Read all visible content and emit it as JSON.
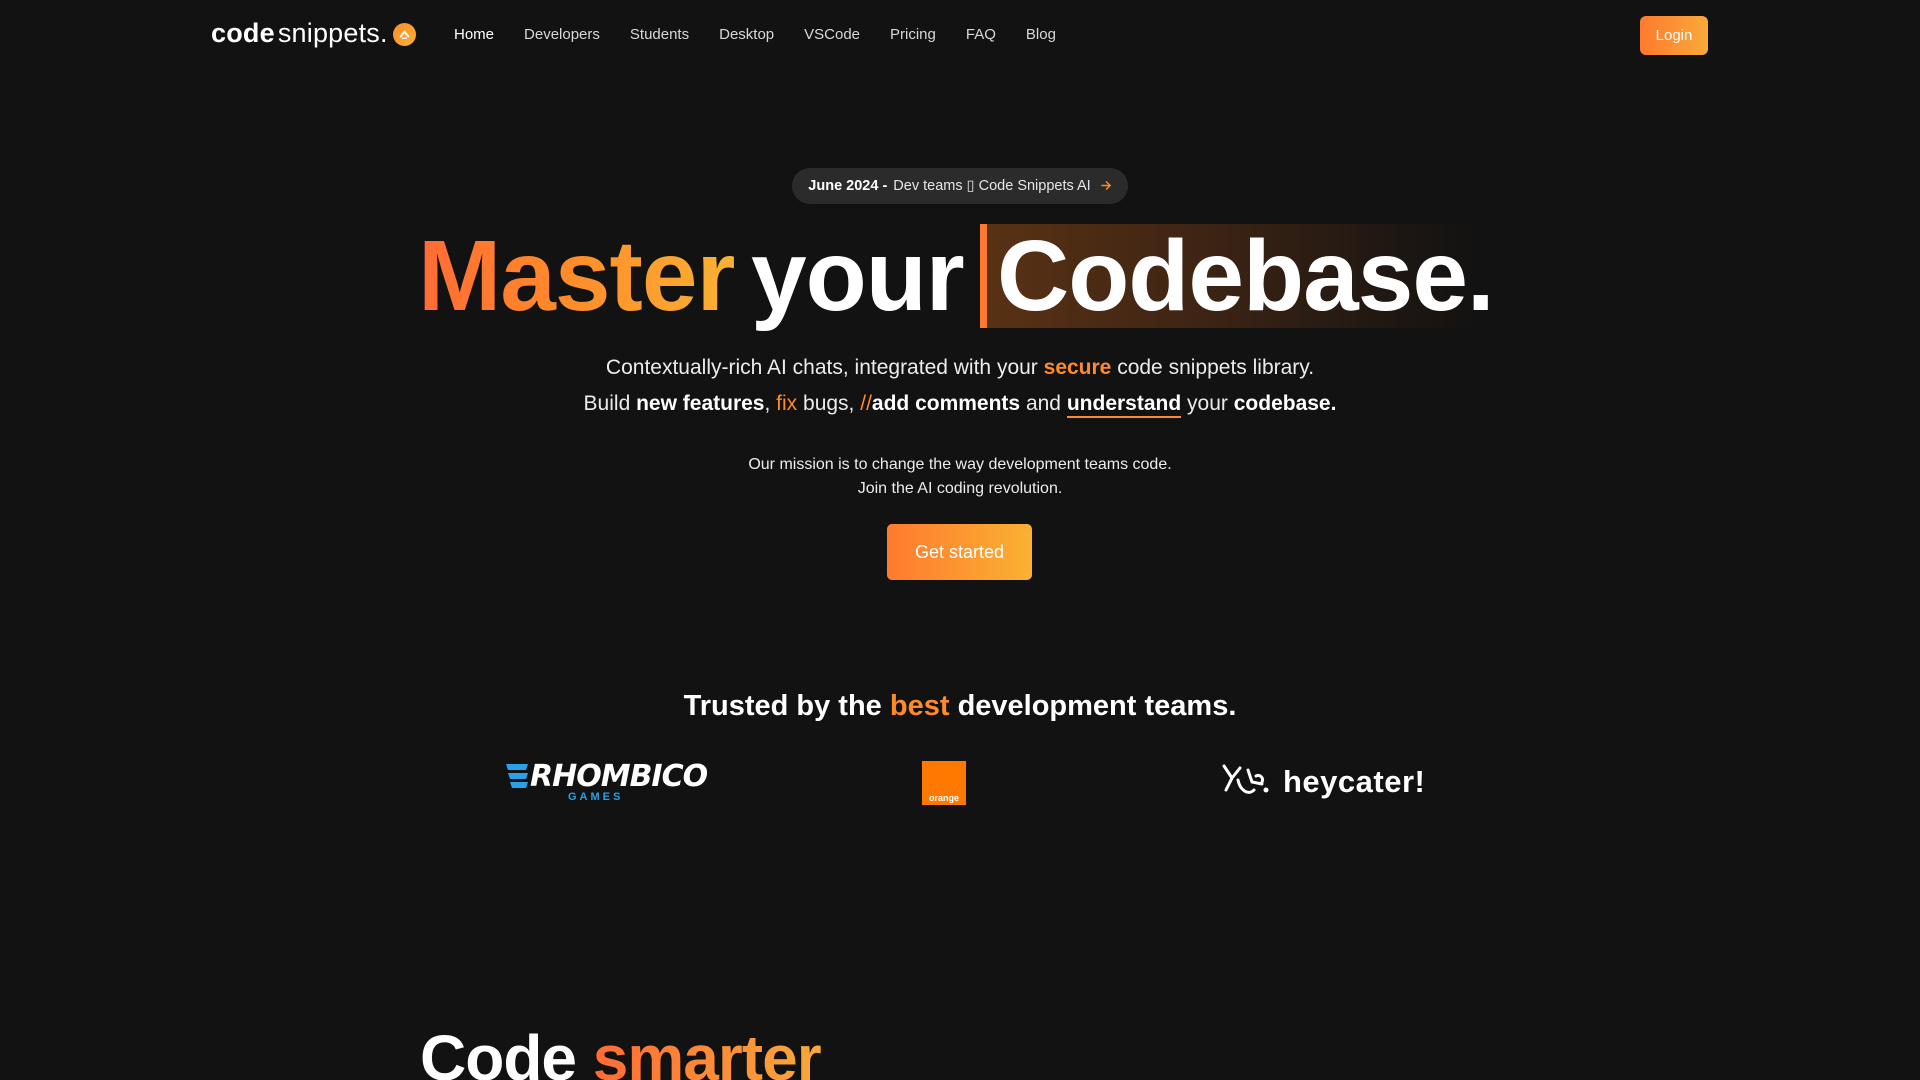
{
  "brand": {
    "name_bold": "code",
    "name_regular": "snippets.",
    "badge_icon": "chevron-up-icon",
    "accent": "#ff8a2a",
    "accent_end": "#f9b233"
  },
  "nav": {
    "items": [
      {
        "label": "Home",
        "active": true
      },
      {
        "label": "Developers"
      },
      {
        "label": "Students"
      },
      {
        "label": "Desktop"
      },
      {
        "label": "VSCode"
      },
      {
        "label": "Pricing"
      },
      {
        "label": "FAQ"
      },
      {
        "label": "Blog"
      }
    ],
    "login_label": "Login"
  },
  "announcement": {
    "date": "June 2024 -",
    "text": "Dev teams ▯ Code Snippets AI",
    "arrow_icon": "arrow-right-icon"
  },
  "hero": {
    "word1": "Master",
    "word2": "your",
    "word3": "Codebase.",
    "line1": {
      "a": "Contextually-rich AI chats, integrated with your",
      "secure": "secure",
      "b": "code snippets library."
    },
    "line2": {
      "build": "Build",
      "new_features": "new features",
      "comma1": ",",
      "fix": "fix",
      "bugs": "bugs,",
      "slashes": "//",
      "add_comments": "add comments",
      "and": "and",
      "understand": "understand",
      "your": "your",
      "codebase": "codebase."
    },
    "mission_line1": "Our mission is to change the way development teams code.",
    "mission_line2": "Join the AI coding revolution.",
    "cta_label": "Get started"
  },
  "trusted": {
    "pre": "Trusted by the",
    "highlight": "best",
    "post": "development teams.",
    "logos": {
      "rhombico": {
        "main": "RHOMBICO",
        "sub": "GAMES"
      },
      "orange": {
        "label": "orange"
      },
      "heycater": {
        "label": "heycater!"
      }
    }
  },
  "section2": {
    "word1": "Code",
    "word2": "smarter"
  }
}
